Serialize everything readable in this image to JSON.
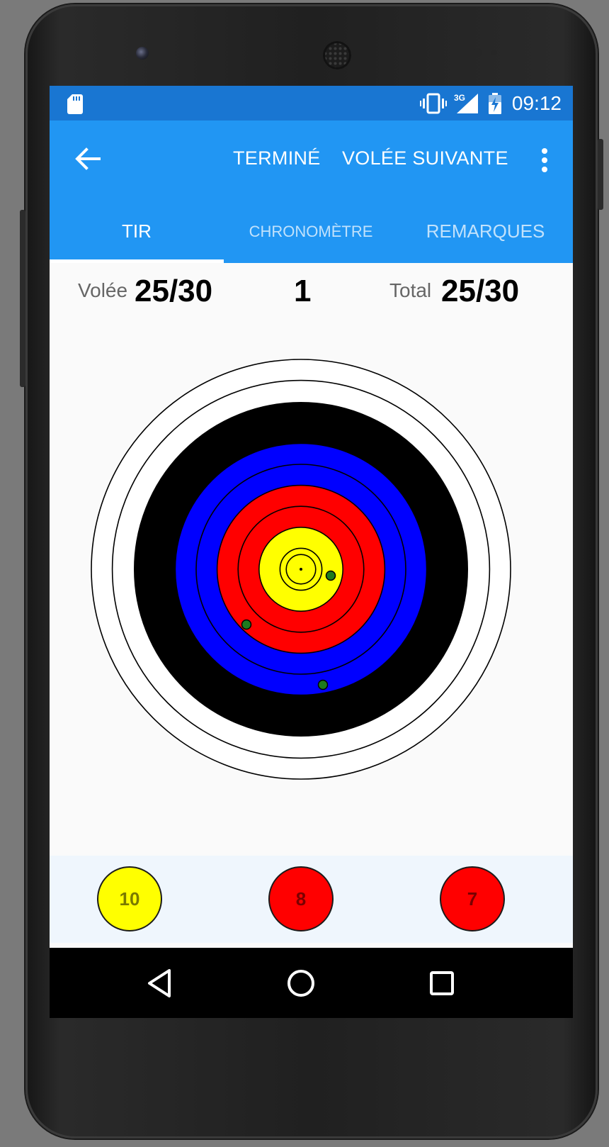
{
  "statusbar": {
    "network": "3G",
    "time": "09:12",
    "icons": [
      "sd-card-icon",
      "vibrate-icon",
      "signal-3g-icon",
      "battery-charging-icon"
    ]
  },
  "appbar": {
    "back_icon": "arrow-back-icon",
    "done_label": "TERMINÉ",
    "next_label": "VOLÉE SUIVANTE",
    "more_icon": "more-vert-icon"
  },
  "tabs": [
    {
      "label": "TIR",
      "selected": true
    },
    {
      "label": "CHRONOMÈTRE",
      "selected": false
    },
    {
      "label": "REMARQUES",
      "selected": false
    }
  ],
  "score": {
    "end_label": "Volée",
    "end_value": "25/30",
    "end_number": "1",
    "total_label": "Total",
    "total_value": "25/30"
  },
  "target": {
    "ring_colors": {
      "white": "#ffffff",
      "black": "#000000",
      "blue": "#0000ff",
      "red": "#ff0000",
      "yellow": "#ffff00"
    },
    "arrow_color": "#1e7a1e"
  },
  "arrows": [
    {
      "score": "10",
      "color": "#ffff00",
      "text_color": "#7a7a00"
    },
    {
      "score": "8",
      "color": "#ff0000",
      "text_color": "#7a0000"
    },
    {
      "score": "7",
      "color": "#ff0000",
      "text_color": "#7a0000"
    }
  ],
  "navbar": {
    "icons": [
      "nav-back-icon",
      "nav-home-icon",
      "nav-recents-icon"
    ]
  }
}
